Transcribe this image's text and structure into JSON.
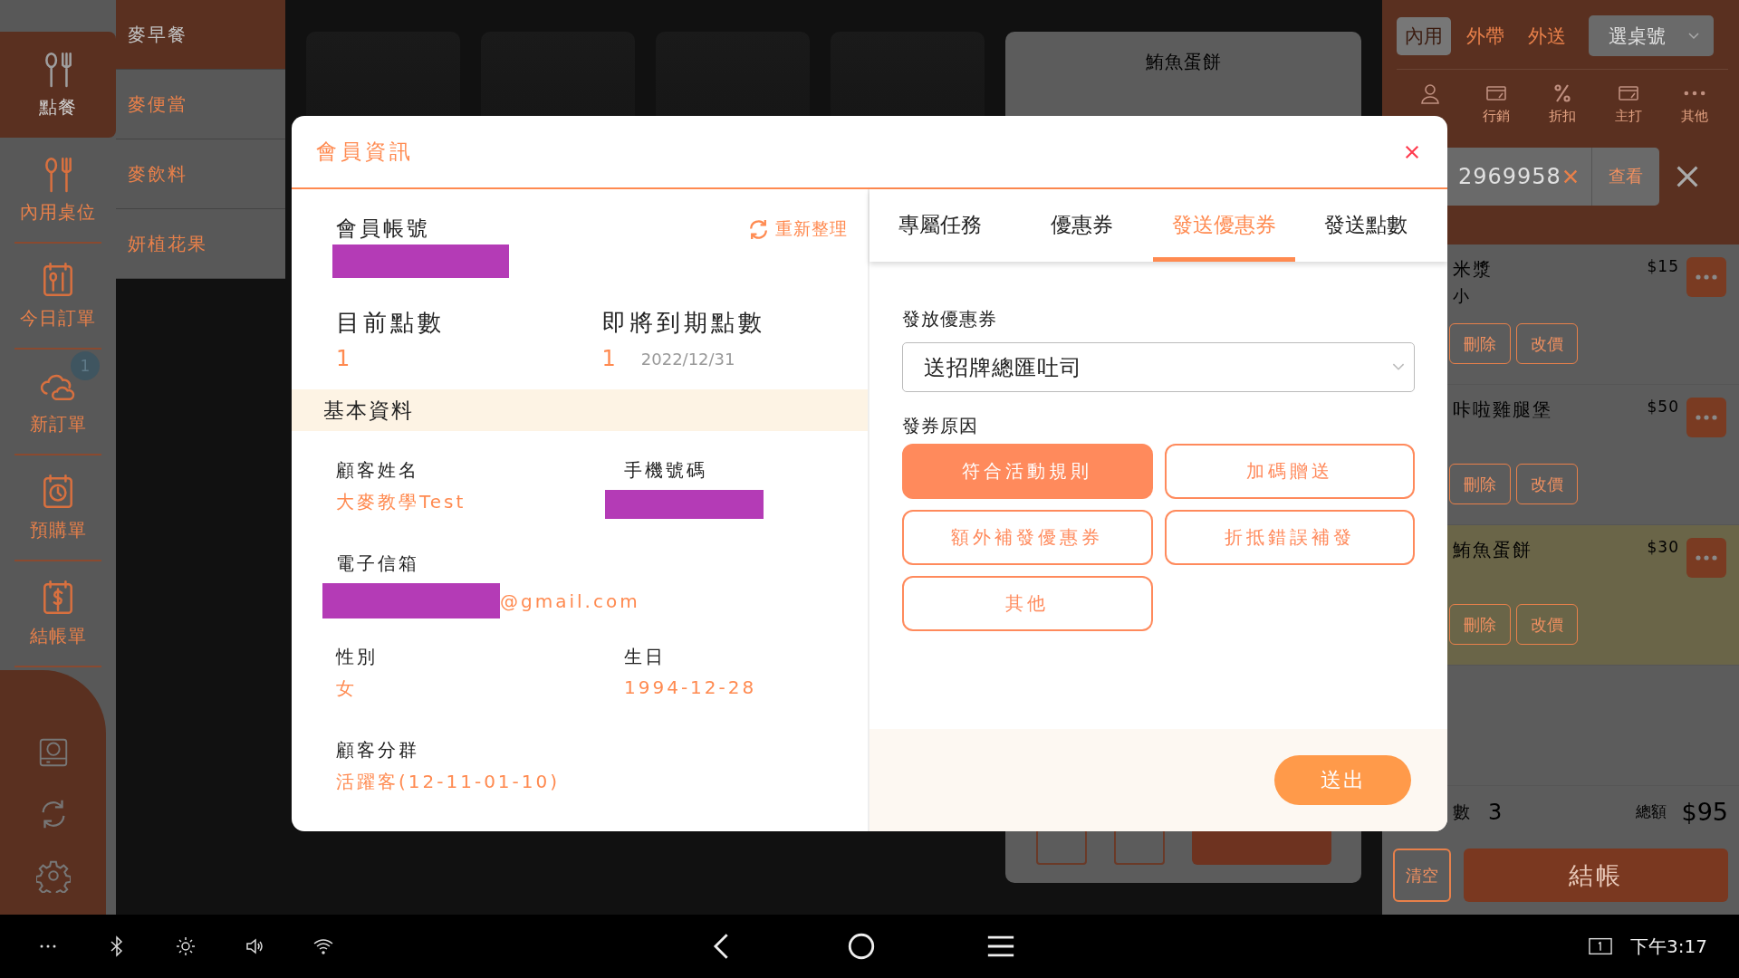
{
  "nav": {
    "items": [
      {
        "label": "點餐",
        "selected": true
      },
      {
        "label": "內用桌位",
        "selected": false
      },
      {
        "label": "今日訂單",
        "selected": false
      },
      {
        "label": "新訂單",
        "selected": false,
        "badge": "1"
      },
      {
        "label": "預購單",
        "selected": false
      },
      {
        "label": "結帳單",
        "selected": false
      }
    ]
  },
  "categories": [
    {
      "label": "麥早餐",
      "selected": true
    },
    {
      "label": "麥便當",
      "selected": false
    },
    {
      "label": "麥飲料",
      "selected": false
    },
    {
      "label": "妍植花果",
      "selected": false
    }
  ],
  "product_panel": {
    "title": "鮪魚蛋餅"
  },
  "order_panel": {
    "order_types": [
      {
        "label": "內用",
        "selected": true
      },
      {
        "label": "外帶",
        "selected": false
      },
      {
        "label": "外送",
        "selected": false
      }
    ],
    "table_select": {
      "placeholder": "選桌號"
    },
    "tools": [
      "行銷",
      "折扣",
      "主打",
      "其他"
    ],
    "member_search": {
      "value": "2969958",
      "button": "查看"
    },
    "items": [
      {
        "name": "米漿",
        "option": "小",
        "price": "$15",
        "highlighted": false,
        "actions": [
          "刪除",
          "改價"
        ]
      },
      {
        "name": "咔啦雞腿堡",
        "price": "$50",
        "highlighted": false,
        "actions": [
          "刪除",
          "改價"
        ]
      },
      {
        "name": "鮪魚蛋餅",
        "price": "$30",
        "highlighted": true,
        "actions": [
          "刪除",
          "改價"
        ]
      }
    ],
    "summary": {
      "count_label": "數",
      "count": "3",
      "total_label": "總額",
      "total": "$95"
    },
    "clear_button": "清空",
    "checkout_button": "結帳"
  },
  "modal": {
    "title": "會員資訊",
    "refresh": "重新整理",
    "account_label": "會員帳號",
    "account_redacted": true,
    "points_label": "目前點數",
    "points": "1",
    "expiring_label": "即將到期點數",
    "expiring_points": "1",
    "expiry_date": "2022/12/31",
    "section_title": "基本資料",
    "fields": [
      {
        "label": "顧客姓名",
        "kind": "text",
        "value": "大麥教學Test"
      },
      {
        "label": "手機號碼",
        "kind": "redacted"
      },
      {
        "label": "電子信箱",
        "kind": "redacted-suffix",
        "value": "@gmail.com"
      },
      {
        "label": "性別",
        "kind": "text",
        "value": "女"
      },
      {
        "label": "生日",
        "kind": "text",
        "value": "1994-12-28"
      },
      {
        "label": "顧客分群",
        "kind": "text",
        "value": "活躍客(12-11-01-10)"
      }
    ],
    "tabs": [
      {
        "label": "專屬任務",
        "selected": false
      },
      {
        "label": "優惠券",
        "selected": false
      },
      {
        "label": "發送優惠券",
        "selected": true
      },
      {
        "label": "發送點數",
        "selected": false
      }
    ],
    "coupon_label": "發放優惠券",
    "coupon_value": "送招牌總匯吐司",
    "reason_label": "發券原因",
    "reasons": [
      {
        "label": "符合活動規則",
        "selected": true
      },
      {
        "label": "加碼贈送",
        "selected": false
      },
      {
        "label": "額外補發優惠券",
        "selected": false
      },
      {
        "label": "折抵錯誤補發",
        "selected": false
      },
      {
        "label": "其他",
        "selected": false
      }
    ],
    "submit": "送出"
  },
  "system_bar": {
    "time": "下午3:17"
  }
}
